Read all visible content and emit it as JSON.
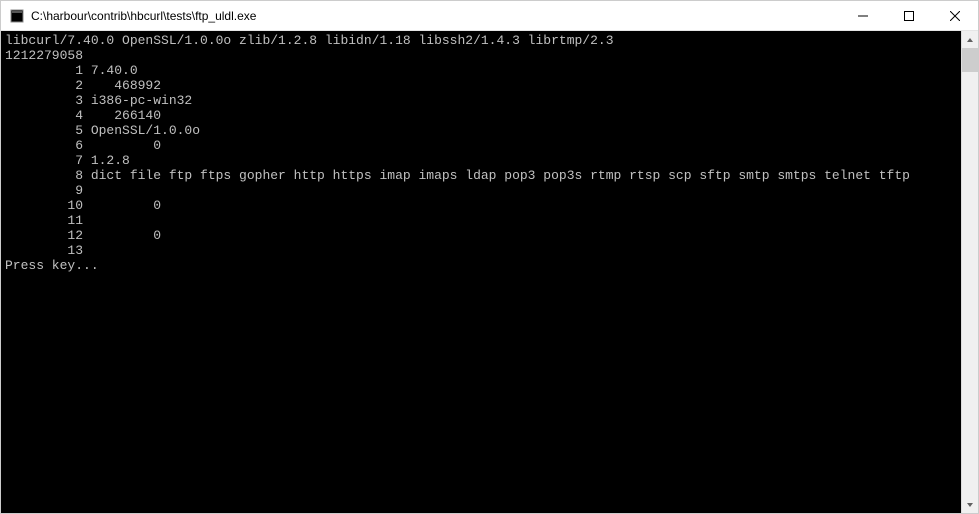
{
  "window": {
    "title": "C:\\harbour\\contrib\\hbcurl\\tests\\ftp_uldl.exe"
  },
  "console": {
    "header_line": "libcurl/7.40.0 OpenSSL/1.0.0o zlib/1.2.8 libidn/1.18 libssh2/1.4.3 librtmp/2.3",
    "number_line": "1212279058",
    "rows": [
      {
        "idx": "1",
        "value": "7.40.0"
      },
      {
        "idx": "2",
        "value": "   468992"
      },
      {
        "idx": "3",
        "value": "i386-pc-win32"
      },
      {
        "idx": "4",
        "value": "   266140"
      },
      {
        "idx": "5",
        "value": "OpenSSL/1.0.0o"
      },
      {
        "idx": "6",
        "value": "        0"
      },
      {
        "idx": "7",
        "value": "1.2.8"
      },
      {
        "idx": "8",
        "value": "dict file ftp ftps gopher http https imap imaps ldap pop3 pop3s rtmp rtsp scp sftp smtp smtps telnet tftp"
      },
      {
        "idx": "9",
        "value": ""
      },
      {
        "idx": "10",
        "value": "        0"
      },
      {
        "idx": "11",
        "value": ""
      },
      {
        "idx": "12",
        "value": "        0"
      },
      {
        "idx": "13",
        "value": ""
      }
    ],
    "prompt": "Press key..."
  }
}
